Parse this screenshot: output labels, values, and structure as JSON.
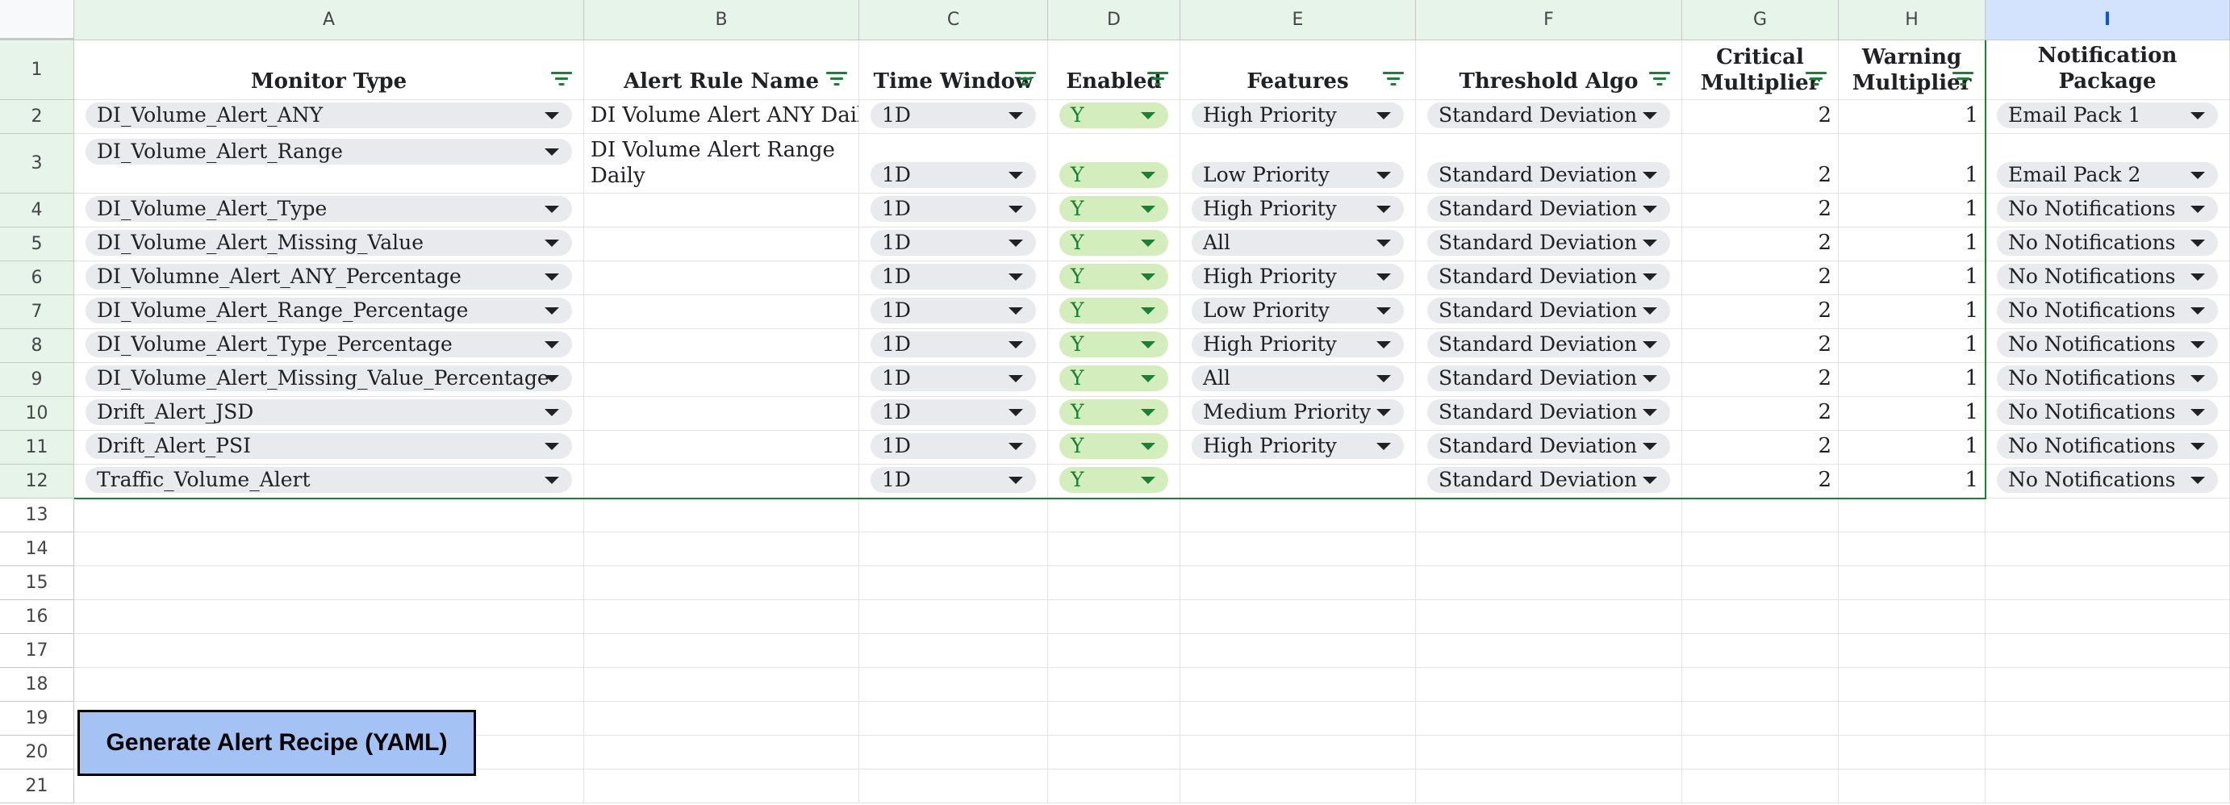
{
  "columns": [
    "A",
    "B",
    "C",
    "D",
    "E",
    "F",
    "G",
    "H",
    "I"
  ],
  "selected_column": "I",
  "row_numbers": [
    "1",
    "2",
    "3",
    "4",
    "5",
    "6",
    "7",
    "8",
    "9",
    "10",
    "11",
    "12",
    "13",
    "14",
    "15",
    "16",
    "17",
    "18",
    "19",
    "20",
    "21"
  ],
  "headers": {
    "A": "Monitor Type",
    "B": "Alert Rule Name",
    "C": "Time Window",
    "D": "Enabled",
    "E": "Features",
    "F": "Threshold Algo",
    "G": [
      "Critical",
      "Multiplier"
    ],
    "H": [
      "Warning",
      "Multiplier"
    ],
    "I": "Notification Package"
  },
  "filter_columns": [
    "A",
    "B",
    "C",
    "D",
    "E",
    "F",
    "G",
    "H"
  ],
  "rows": [
    {
      "monitor_type": "DI_Volume_Alert_ANY",
      "alert_rule_name": "DI Volume Alert ANY Daily",
      "time_window": "1D",
      "enabled": "Y",
      "features": "High Priority",
      "threshold_algo": "Standard Deviation",
      "critical_multiplier": "2",
      "warning_multiplier": "1",
      "notification_package": "Email Pack 1"
    },
    {
      "monitor_type": "DI_Volume_Alert_Range",
      "alert_rule_name": "DI Volume Alert Range Daily",
      "time_window": "1D",
      "enabled": "Y",
      "features": "Low Priority",
      "threshold_algo": "Standard Deviation",
      "critical_multiplier": "2",
      "warning_multiplier": "1",
      "notification_package": "Email Pack 2"
    },
    {
      "monitor_type": "DI_Volume_Alert_Type",
      "alert_rule_name": "",
      "time_window": "1D",
      "enabled": "Y",
      "features": "High Priority",
      "threshold_algo": "Standard Deviation",
      "critical_multiplier": "2",
      "warning_multiplier": "1",
      "notification_package": "No Notifications"
    },
    {
      "monitor_type": "DI_Volume_Alert_Missing_Value",
      "alert_rule_name": "",
      "time_window": "1D",
      "enabled": "Y",
      "features": "All",
      "threshold_algo": "Standard Deviation",
      "critical_multiplier": "2",
      "warning_multiplier": "1",
      "notification_package": "No Notifications"
    },
    {
      "monitor_type": "DI_Volumne_Alert_ANY_Percentage",
      "alert_rule_name": "",
      "time_window": "1D",
      "enabled": "Y",
      "features": "High Priority",
      "threshold_algo": "Standard Deviation",
      "critical_multiplier": "2",
      "warning_multiplier": "1",
      "notification_package": "No Notifications"
    },
    {
      "monitor_type": "DI_Volume_Alert_Range_Percentage",
      "alert_rule_name": "",
      "time_window": "1D",
      "enabled": "Y",
      "features": "Low Priority",
      "threshold_algo": "Standard Deviation",
      "critical_multiplier": "2",
      "warning_multiplier": "1",
      "notification_package": "No Notifications"
    },
    {
      "monitor_type": "DI_Volume_Alert_Type_Percentage",
      "alert_rule_name": "",
      "time_window": "1D",
      "enabled": "Y",
      "features": "High Priority",
      "threshold_algo": "Standard Deviation",
      "critical_multiplier": "2",
      "warning_multiplier": "1",
      "notification_package": "No Notifications"
    },
    {
      "monitor_type": "DI_Volume_Alert_Missing_Value_Percentage",
      "alert_rule_name": "",
      "time_window": "1D",
      "enabled": "Y",
      "features": "All",
      "threshold_algo": "Standard Deviation",
      "critical_multiplier": "2",
      "warning_multiplier": "1",
      "notification_package": "No Notifications"
    },
    {
      "monitor_type": "Drift_Alert_JSD",
      "alert_rule_name": "",
      "time_window": "1D",
      "enabled": "Y",
      "features": "Medium Priority",
      "threshold_algo": "Standard Deviation",
      "critical_multiplier": "2",
      "warning_multiplier": "1",
      "notification_package": "No Notifications"
    },
    {
      "monitor_type": "Drift_Alert_PSI",
      "alert_rule_name": "",
      "time_window": "1D",
      "enabled": "Y",
      "features": "High Priority",
      "threshold_algo": "Standard Deviation",
      "critical_multiplier": "2",
      "warning_multiplier": "1",
      "notification_package": "No Notifications"
    },
    {
      "monitor_type": "Traffic_Volume_Alert",
      "alert_rule_name": "",
      "time_window": "1D",
      "enabled": "Y",
      "features": "",
      "threshold_algo": "Standard Deviation",
      "critical_multiplier": "2",
      "warning_multiplier": "1",
      "notification_package": "No Notifications"
    }
  ],
  "generate_button_label": "Generate Alert Recipe (YAML)",
  "colors": {
    "header_bg": "#e6f4ea",
    "selected_header_bg": "#d3e3fd",
    "chip_bg": "#e8eaed",
    "enabled_chip_bg": "#d4edbc",
    "enabled_chip_text": "#188038",
    "button_bg": "#a4c2f4",
    "filter_icon": "#188038"
  }
}
